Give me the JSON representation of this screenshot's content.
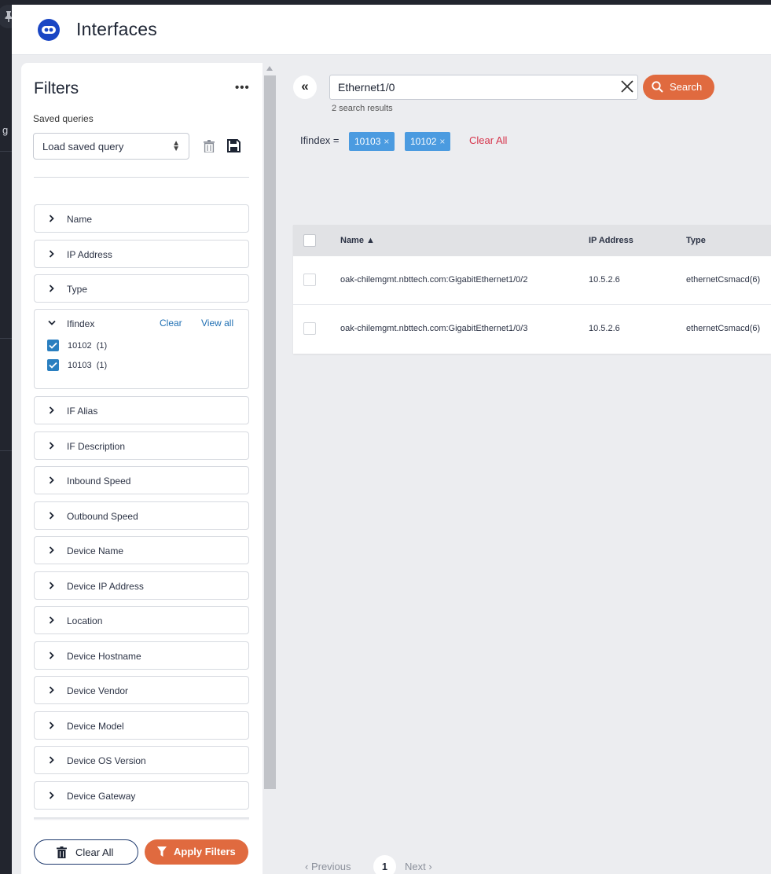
{
  "app": {
    "title": "Interfaces",
    "accent": "#e06a3f",
    "link_color": "#1f6fb3",
    "rail_cut_text": "g"
  },
  "filters": {
    "title": "Filters",
    "menu_label": "•••",
    "saved_queries_label": "Saved queries",
    "saved_query_select": "Load saved query",
    "facets_before": [
      "Name",
      "IP Address",
      "Type"
    ],
    "open_facet": {
      "label": "Ifindex",
      "clear_label": "Clear",
      "view_all_label": "View all",
      "options": [
        {
          "value": "10102",
          "count": "(1)",
          "checked": true
        },
        {
          "value": "10103",
          "count": "(1)",
          "checked": true
        }
      ]
    },
    "facets_after": [
      "IF Alias",
      "IF Description",
      "Inbound Speed",
      "Outbound Speed",
      "Device Name",
      "Device IP Address",
      "Location",
      "Device Hostname",
      "Device Vendor",
      "Device Model",
      "Device OS Version",
      "Device Gateway"
    ],
    "clear_all_label": "Clear All",
    "apply_label": "Apply Filters"
  },
  "search": {
    "collapse_label": "«",
    "value": "Ethernet1/0",
    "button_label": "Search",
    "results_count": "2 search results"
  },
  "active_filters": {
    "key": "Ifindex =",
    "chips": [
      "10103",
      "10102"
    ],
    "clear_all_label": "Clear All"
  },
  "table": {
    "columns": {
      "name": "Name ▲",
      "ip": "IP Address",
      "type": "Type"
    },
    "rows": [
      {
        "name": "oak-chilemgmt.nbttech.com:GigabitEthernet1/0/2",
        "ip": "10.5.2.6",
        "type": "ethernetCsmacd(6)"
      },
      {
        "name": "oak-chilemgmt.nbttech.com:GigabitEthernet1/0/3",
        "ip": "10.5.2.6",
        "type": "ethernetCsmacd(6)"
      }
    ]
  },
  "pagination": {
    "previous": "‹  Previous",
    "page": "1",
    "next": "Next  ›"
  }
}
